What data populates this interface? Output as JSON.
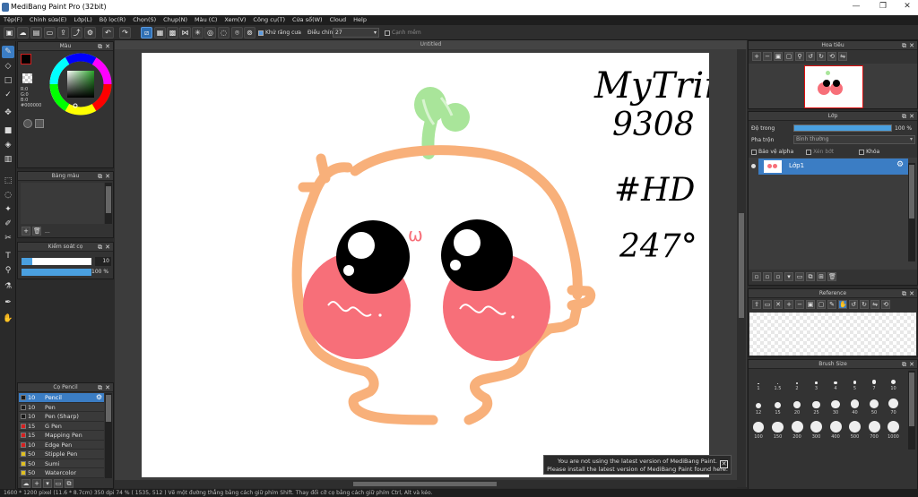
{
  "window": {
    "title": "MediBang Paint Pro (32bit)",
    "minimize": "—",
    "maximize": "❐",
    "close": "✕"
  },
  "menu": [
    "Tệp(F)",
    "Chỉnh sửa(E)",
    "Lớp(L)",
    "Bộ lọc(R)",
    "Chọn(S)",
    "Chụp(N)",
    "Màu (C)",
    "Xem(V)",
    "Công cụ(T)",
    "Cửa sổ(W)",
    "Cloud",
    "Help"
  ],
  "toolbar": {
    "antialias_label": "Khử răng cưa",
    "adjust_label": "Điều chỉnh",
    "adjust_value": "27",
    "edge_label": "Cạnh mềm"
  },
  "document": {
    "tab_title": "Untitled"
  },
  "color_panel": {
    "title": "Màu",
    "readout": [
      "R:0",
      "G:0",
      "B:0"
    ],
    "hex": "#000000",
    "fg_color": "#000000",
    "accent_red": "#d62020"
  },
  "palette_panel": {
    "title": "Bảng màu",
    "more": "..."
  },
  "brush_control": {
    "title": "Kiểm soát cọ",
    "size_value": "10",
    "opacity_value": "100 %",
    "size_fraction": 0.15,
    "opacity_fraction": 1.0
  },
  "brush_panel": {
    "title": "Cọ Pencil",
    "items": [
      {
        "size": "10",
        "name": "Pencil",
        "color": "#1a1a1a",
        "selected": true
      },
      {
        "size": "10",
        "name": "Pen",
        "color": "#1a1a1a"
      },
      {
        "size": "10",
        "name": "Pen (Sharp)",
        "color": "#1a1a1a"
      },
      {
        "size": "15",
        "name": "G Pen",
        "color": "#d62020"
      },
      {
        "size": "15",
        "name": "Mapping Pen",
        "color": "#d62020"
      },
      {
        "size": "10",
        "name": "Edge Pen",
        "color": "#d62020"
      },
      {
        "size": "50",
        "name": "Stipple Pen",
        "color": "#e0c020"
      },
      {
        "size": "50",
        "name": "Sumi",
        "color": "#e0c020"
      },
      {
        "size": "50",
        "name": "Watercolor",
        "color": "#e0c020"
      }
    ]
  },
  "navigator": {
    "title": "Hoa tiêu"
  },
  "layer_panel": {
    "title": "Lớp",
    "opacity_label": "Độ trong",
    "opacity_value": "100 %",
    "blend_label": "Pha trộn",
    "blend_value": "Bình thường",
    "protect_alpha": "Bảo vệ alpha",
    "clip": "Xén bớt",
    "lock": "Khóa",
    "layers": [
      {
        "name": "Lớp1",
        "selected": true
      }
    ]
  },
  "reference": {
    "title": "Reference"
  },
  "brush_size": {
    "title": "Brush Size",
    "sizes": [
      "1",
      "1.5",
      "2",
      "3",
      "4",
      "5",
      "7",
      "10",
      "12",
      "15",
      "20",
      "25",
      "30",
      "40",
      "50",
      "70",
      "100",
      "150",
      "200",
      "300",
      "400",
      "500",
      "700",
      "1000"
    ]
  },
  "drawing_text": {
    "line1": "MyTrinh",
    "line2": "9308",
    "line3": "#HD",
    "line4": "247°",
    "blush_mark": "ω"
  },
  "notification": {
    "line1": "You are not using the latest version of MediBang Paint.",
    "line2": "Please install the latest version of MediBang Paint found here.",
    "close": "✕"
  },
  "status_bar": "1600 * 1200 pixel   (11.6 * 8.7cm)   350 dpi   74 %   ( 1535, 512 )   Vẽ một đường thẳng bằng cách giữ phím Shift. Thay đổi cỡ cọ bằng cách giữ phím Ctrl, Alt và kéo."
}
